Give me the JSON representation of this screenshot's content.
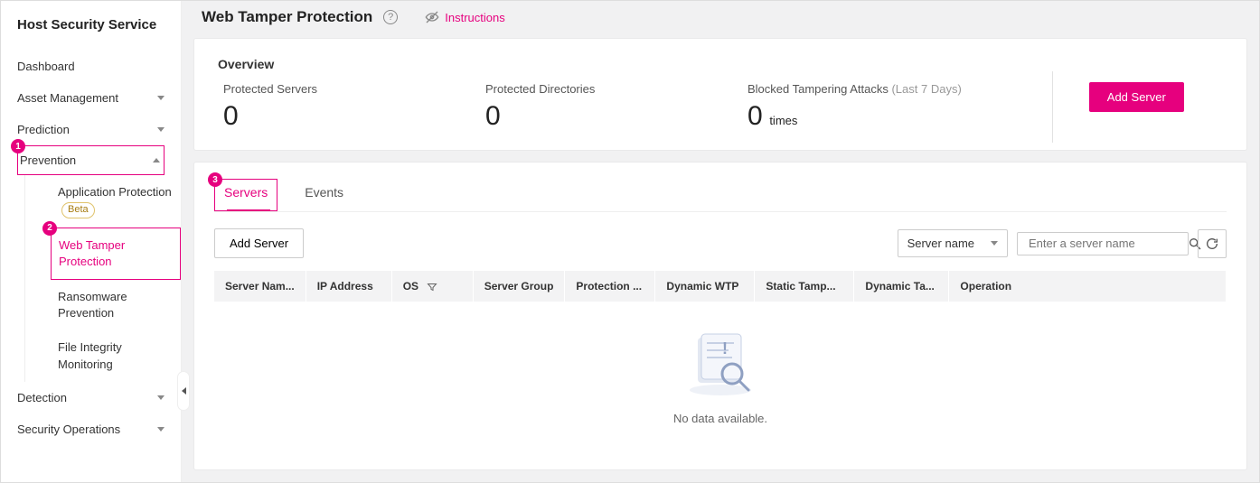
{
  "sidebar": {
    "title": "Host Security Service",
    "items": {
      "dashboard": "Dashboard",
      "asset": "Asset Management",
      "prediction": "Prediction",
      "prevention": "Prevention",
      "detection": "Detection",
      "secops": "Security Operations"
    },
    "prevention_sub": {
      "app_protection": "Application Protection",
      "beta": "Beta",
      "wtp": "Web Tamper Protection",
      "ransomware": "Ransomware Prevention",
      "fim": "File Integrity Monitoring"
    }
  },
  "callouts": {
    "one": "1",
    "two": "2",
    "three": "3"
  },
  "header": {
    "title": "Web Tamper Protection",
    "instructions": "Instructions"
  },
  "overview": {
    "heading": "Overview",
    "protected_servers_label": "Protected Servers",
    "protected_servers_value": "0",
    "protected_dirs_label": "Protected Directories",
    "protected_dirs_value": "0",
    "blocked_label": "Blocked Tampering Attacks",
    "blocked_sub": "(Last 7 Days)",
    "blocked_value": "0",
    "blocked_unit": "times",
    "add_server": "Add Server"
  },
  "tabs": {
    "servers": "Servers",
    "events": "Events"
  },
  "toolbar": {
    "add_server": "Add Server",
    "filter_field": "Server name",
    "search_placeholder": "Enter a server name"
  },
  "table": {
    "cols": {
      "name": "Server Nam...",
      "ip": "IP Address",
      "os": "OS",
      "group": "Server Group",
      "protection": "Protection ...",
      "dyn_wtp": "Dynamic WTP",
      "static_tamp": "Static Tamp...",
      "dyn_tamp": "Dynamic Ta...",
      "operation": "Operation"
    },
    "empty": "No data available."
  }
}
